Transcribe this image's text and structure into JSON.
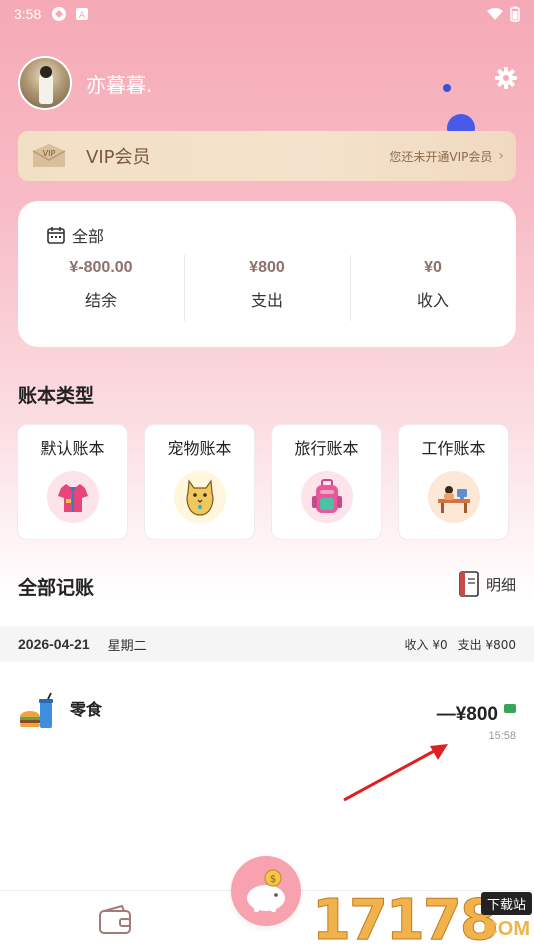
{
  "status_bar": {
    "time": "3:58"
  },
  "profile": {
    "username": "亦暮暮."
  },
  "vip": {
    "title": "VIP会员",
    "status": "您还未开通VIP会员",
    "badge": "VIP"
  },
  "summary": {
    "filter_label": "全部",
    "balance": {
      "value": "¥-800.00",
      "label": "结余"
    },
    "expense": {
      "value": "¥800",
      "label": "支出"
    },
    "income": {
      "value": "¥0",
      "label": "收入"
    }
  },
  "books_section": {
    "title": "账本类型",
    "items": [
      {
        "name": "默认账本",
        "icon": "shirt-icon"
      },
      {
        "name": "宠物账本",
        "icon": "cat-icon"
      },
      {
        "name": "旅行账本",
        "icon": "backpack-icon"
      },
      {
        "name": "工作账本",
        "icon": "desk-icon"
      }
    ]
  },
  "records_section": {
    "title": "全部记账",
    "detail_label": "明细"
  },
  "day_group": {
    "date": "2026-04-21",
    "weekday": "星期二",
    "income": "收入 ¥0",
    "expense": "支出 ¥800"
  },
  "record": {
    "category": "零食",
    "amount": "—¥800",
    "time": "15:58",
    "icon": "burger-drink-icon"
  },
  "watermark": {
    "digits": "17178",
    "tag": "下载站",
    "com": ".COM"
  },
  "colors": {
    "accent_pink": "#f7a2ae",
    "amount_brown": "#8e706c",
    "vip_gold": "#f1dfc6"
  }
}
